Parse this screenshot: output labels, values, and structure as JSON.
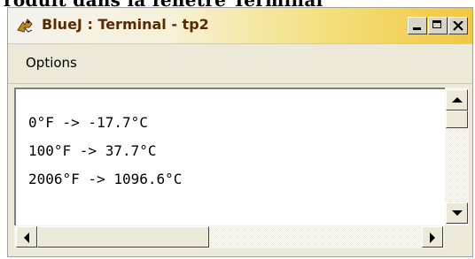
{
  "caption": "roduit dans la fenêtre Terminal",
  "window": {
    "title": "BlueJ : Terminal - tp2",
    "menu": {
      "options_label": "Options"
    },
    "output_lines": [
      "0°F -> -17.7°C",
      "100°F -> 37.7°C",
      "2006°F -> 1096.6°C"
    ],
    "icons": {
      "app": "bluej-bird-icon",
      "minimize": "minimize-icon",
      "maximize": "maximize-icon",
      "close": "close-icon"
    }
  }
}
